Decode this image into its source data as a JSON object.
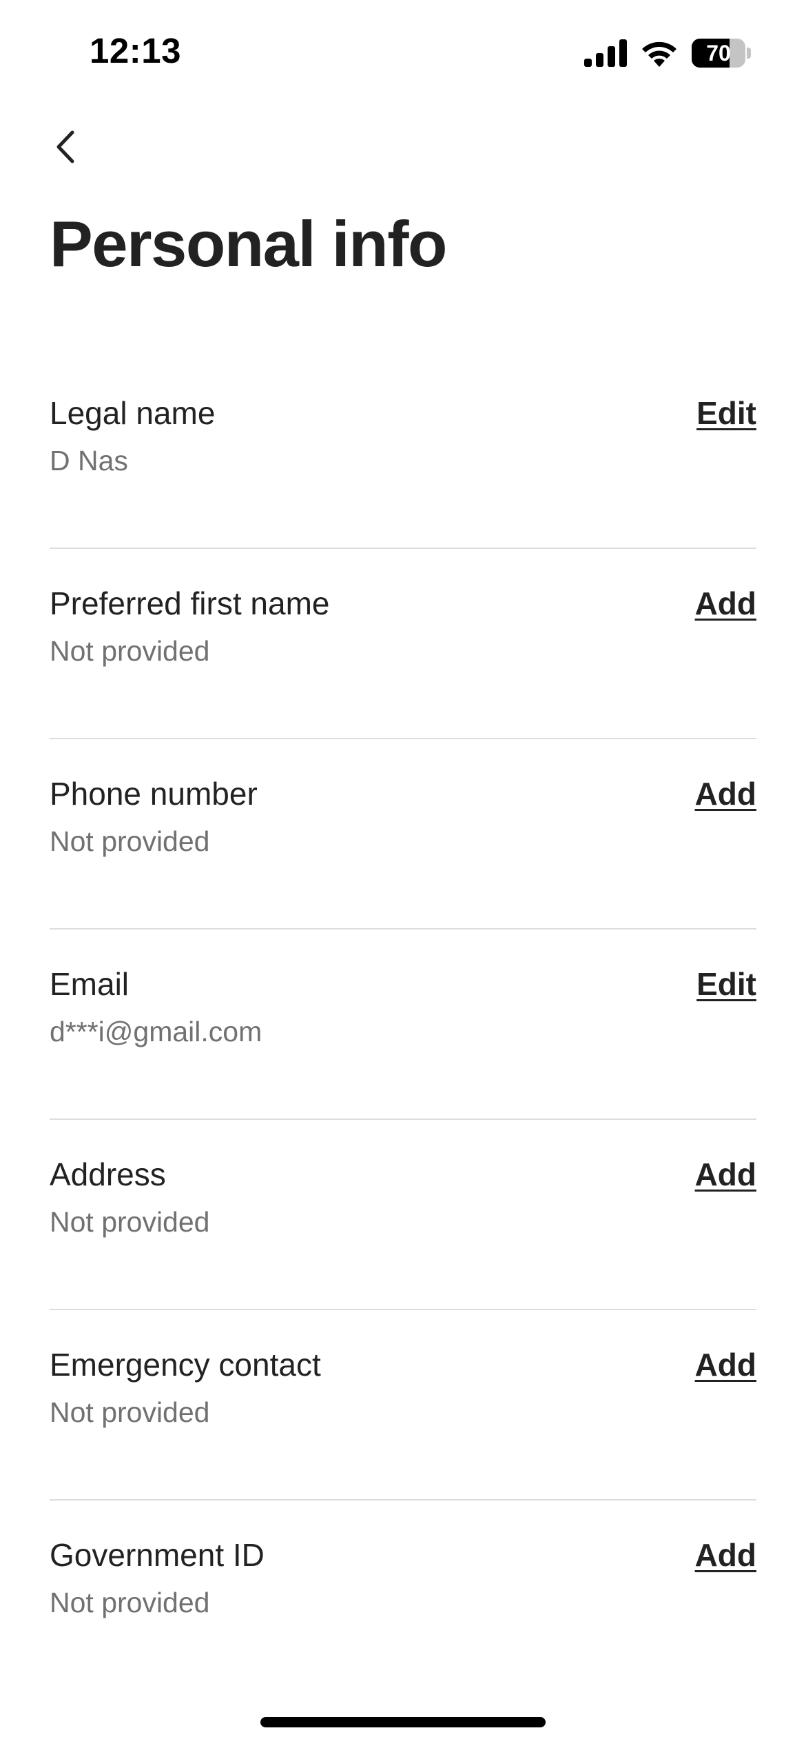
{
  "status_bar": {
    "time": "12:13",
    "battery_level": "70",
    "battery_fraction": 0.7,
    "icons": [
      "signal-icon",
      "wifi-icon",
      "battery-icon"
    ]
  },
  "header": {
    "back_icon": "chevron-left-icon",
    "title": "Personal info"
  },
  "fields": [
    {
      "label": "Legal name",
      "value": "D Nas",
      "action": "Edit"
    },
    {
      "label": "Preferred first name",
      "value": "Not provided",
      "action": "Add"
    },
    {
      "label": "Phone number",
      "value": "Not provided",
      "action": "Add"
    },
    {
      "label": "Email",
      "value": "d***i@gmail.com",
      "action": "Edit"
    },
    {
      "label": "Address",
      "value": "Not provided",
      "action": "Add"
    },
    {
      "label": "Emergency contact",
      "value": "Not provided",
      "action": "Add"
    },
    {
      "label": "Government ID",
      "value": "Not provided",
      "action": "Add"
    }
  ],
  "colors": {
    "text_primary": "#222222",
    "text_secondary": "#717171",
    "divider": "#dddddd",
    "background": "#ffffff"
  }
}
